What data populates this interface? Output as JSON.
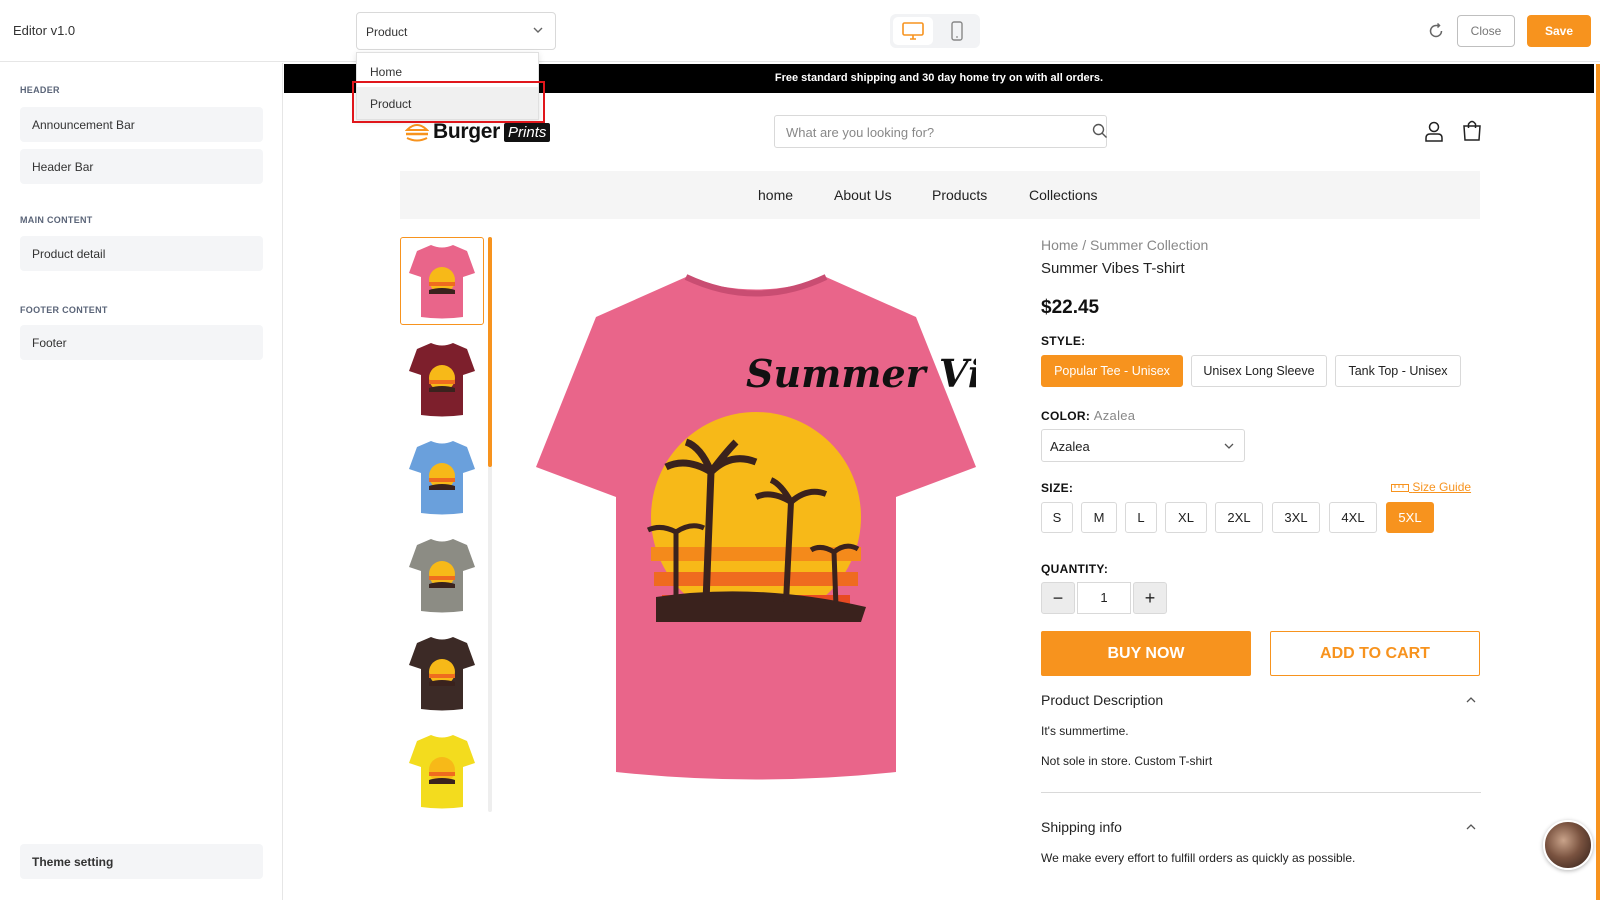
{
  "editor": {
    "title": "Editor v1.0",
    "page_select_value": "Product",
    "close_label": "Close",
    "save_label": "Save",
    "accent_color": "#f7931e"
  },
  "dropdown": {
    "options": [
      "Home",
      "Product"
    ],
    "highlighted": "Product"
  },
  "sidebar": {
    "sections": [
      {
        "label": "HEADER",
        "items": [
          "Announcement Bar",
          "Header Bar"
        ]
      },
      {
        "label": "MAIN CONTENT",
        "items": [
          "Product detail"
        ]
      },
      {
        "label": "FOOTER CONTENT",
        "items": [
          "Footer"
        ]
      }
    ],
    "theme_setting": "Theme setting"
  },
  "store": {
    "announcement": "Free standard shipping and 30 day home try on with all orders.",
    "logo_word": "Burger",
    "logo_badge": "Prints",
    "search_placeholder": "What are you looking for?",
    "nav": [
      "home",
      "About Us",
      "Products",
      "Collections"
    ]
  },
  "product": {
    "breadcrumb": "Home  /  Summer Collection",
    "title": "Summer Vibes T-shirt",
    "price": "$22.45",
    "style_label": "STYLE:",
    "styles": [
      "Popular Tee - Unisex",
      "Unisex Long Sleeve",
      "Tank Top - Unisex"
    ],
    "selected_style": "Popular Tee - Unisex",
    "color_label": "COLOR:",
    "color_value": "Azalea",
    "color_select_value": "Azalea",
    "size_label": "SIZE:",
    "size_guide": "Size Guide",
    "sizes": [
      "S",
      "M",
      "L",
      "XL",
      "2XL",
      "3XL",
      "4XL",
      "5XL"
    ],
    "selected_size": "5XL",
    "quantity_label": "QUANTITY:",
    "quantity": "1",
    "qty_minus": "−",
    "qty_plus": "+",
    "buy_now": "BUY NOW",
    "add_to_cart": "ADD TO CART",
    "description_title": "Product Description",
    "description_lines": [
      "It's summertime.",
      "Not sole in store. Custom T-shirt"
    ],
    "shipping_title": "Shipping info",
    "shipping_text": "We make every effort to fulfill orders as quickly as possible.",
    "thumbnail_colors": [
      "#e9658a",
      "#7d1f2c",
      "#6aa0dc",
      "#8c8c84",
      "#3c2a26",
      "#f3dc1e"
    ],
    "main_shirt_color": "#e9658a",
    "graphic_text": "Summer Vibes"
  }
}
